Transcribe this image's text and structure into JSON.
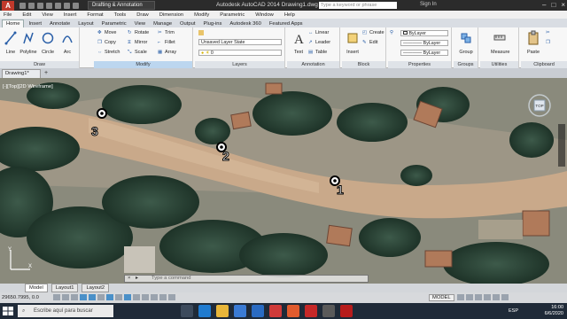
{
  "window": {
    "title": "Autodesk AutoCAD 2014    Drawing1.dwg",
    "app_letter": "A",
    "workspace": "Drafting & Annotation",
    "search_placeholder": "Type a keyword or phrase",
    "sign_in": "Sign In"
  },
  "menu": [
    "File",
    "Edit",
    "View",
    "Insert",
    "Format",
    "Tools",
    "Draw",
    "Dimension",
    "Modify",
    "Parametric",
    "Window",
    "Help"
  ],
  "ribbon_tabs": [
    "Home",
    "Insert",
    "Annotate",
    "Layout",
    "Parametric",
    "View",
    "Manage",
    "Output",
    "Plug-ins",
    "Autodesk 360",
    "Featured Apps"
  ],
  "ribbon": {
    "draw": {
      "label": "Draw",
      "tools": [
        "Line",
        "Polyline",
        "Circle",
        "Arc"
      ]
    },
    "modify": {
      "label": "Modify",
      "tools": [
        "Move",
        "Rotate",
        "Trim",
        "Copy",
        "Mirror",
        "Fillet",
        "Stretch",
        "Scale",
        "Array"
      ]
    },
    "layers": {
      "label": "Layers",
      "state": "Unsaved Layer State",
      "current": "0"
    },
    "annotation": {
      "label": "Annotation",
      "text": "Text",
      "tools": [
        "Linear",
        "Leader",
        "Table"
      ]
    },
    "block": {
      "label": "Block",
      "insert": "Insert",
      "tools": [
        "Create",
        "Edit"
      ]
    },
    "properties": {
      "label": "Properties",
      "color": "ByLayer",
      "linetype": "ByLayer",
      "lineweight": "ByLayer"
    },
    "groups": {
      "label": "Groups",
      "tool": "Group"
    },
    "utilities": {
      "label": "Utilities",
      "tool": "Measure"
    },
    "clipboard": {
      "label": "Clipboard",
      "tool": "Paste"
    }
  },
  "file_tab": "Drawing1*",
  "viewport_label": "[-][Top][2D Wireframe]",
  "markers": [
    "1",
    "2",
    "3"
  ],
  "command_placeholder": "Type a command",
  "layout_tabs": [
    "Model",
    "Layout1",
    "Layout2"
  ],
  "status": {
    "coords": "29650.7995, 0.0",
    "model": "MODEL"
  },
  "taskbar": {
    "search": "Escribe aquí para buscar",
    "lang": "ESP",
    "time": "16:00",
    "date": "6/6/2020"
  },
  "colors": {
    "titlebar": "#2b2b2b",
    "ribbon": "#f7f7f7",
    "taskbar": "#1f2a38",
    "highlight": "#f5e03a"
  }
}
